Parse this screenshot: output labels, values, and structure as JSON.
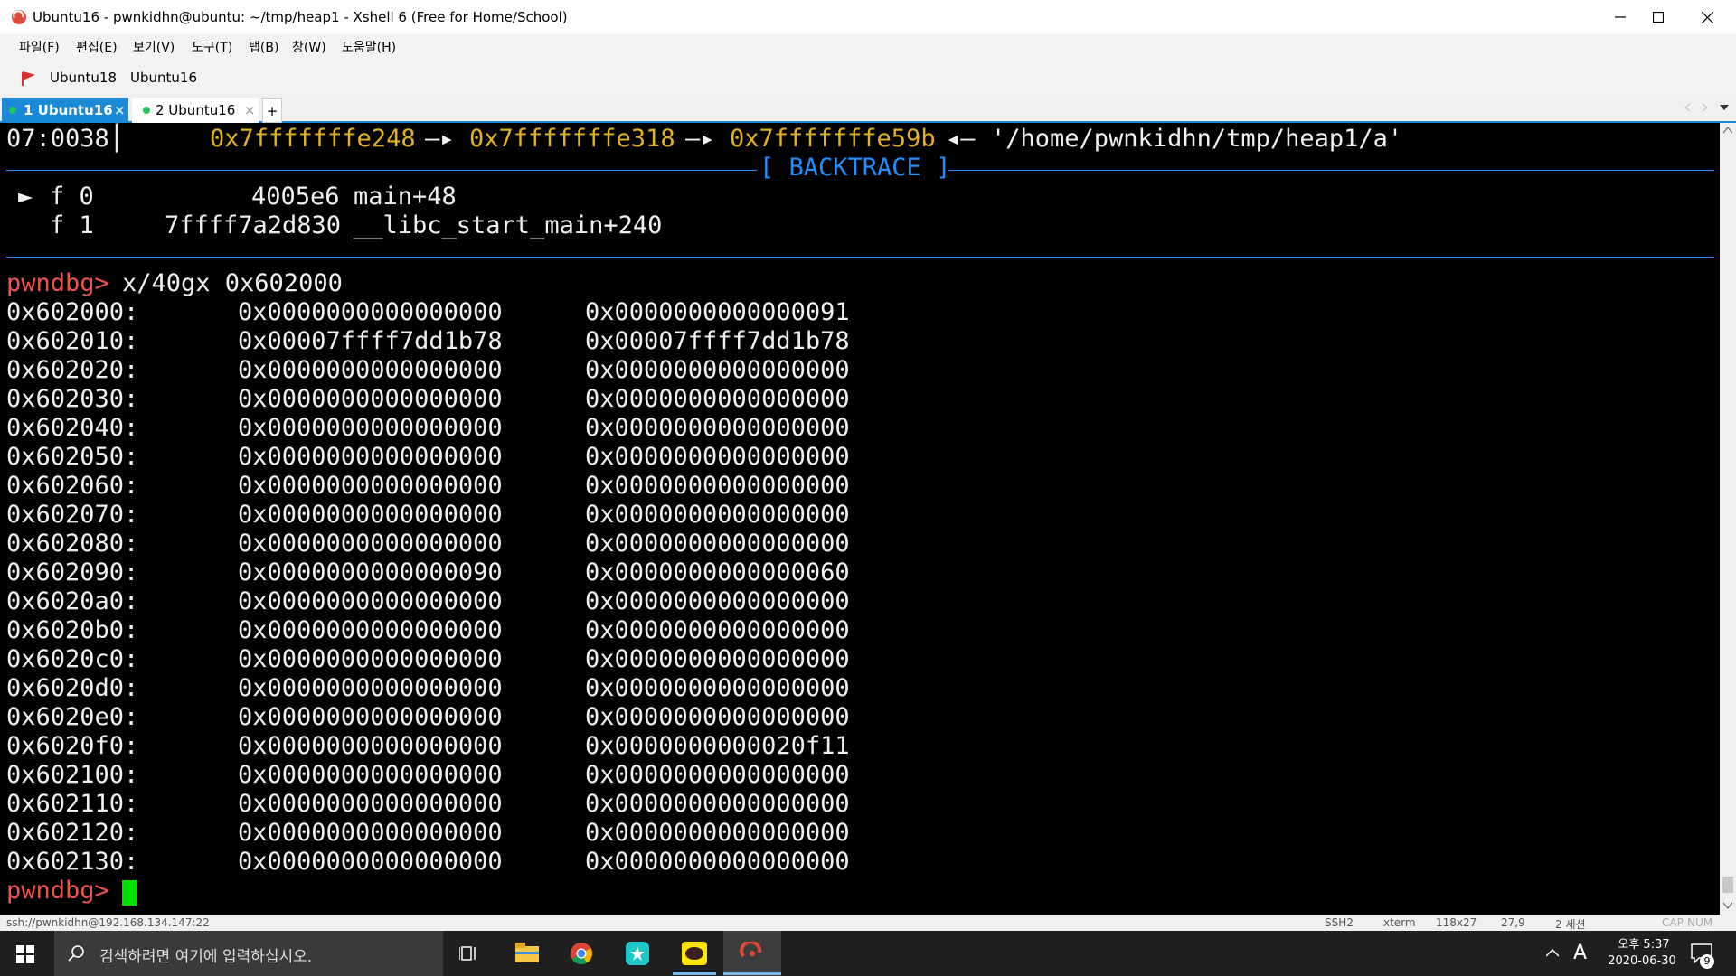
{
  "window": {
    "title": "Ubuntu16 - pwnkidhn@ubuntu: ~/tmp/heap1 - Xshell 6 (Free for Home/School)",
    "minimize": "—",
    "maximize": "☐",
    "close": "✕"
  },
  "menu": [
    "파일(F)",
    "편집(E)",
    "보기(V)",
    "도구(T)",
    "탭(B)",
    "창(W)",
    "도움말(H)"
  ],
  "links": [
    "Ubuntu18",
    "Ubuntu16"
  ],
  "tabs": [
    {
      "label": "1 Ubuntu16",
      "active": true,
      "close": "×"
    },
    {
      "label": "2 Ubuntu16",
      "active": false,
      "close": "×"
    }
  ],
  "new_tab": "+",
  "terminal": {
    "stack_line": {
      "index": "07:0038",
      "sep": "│",
      "p1": "0x7fffffffe248",
      "arrow1": "—▸",
      "p2": "0x7fffffffe318",
      "arrow2": "—▸",
      "p3": "0x7fffffffe59b",
      "arrow3": "◂—",
      "str": "'/home/pwnkidhn/tmp/heap1/a'"
    },
    "backtrace_label": "[ BACKTRACE ]",
    "frames": [
      {
        "marker": "►",
        "f": "f 0",
        "addr": "4005e6",
        "sym": "main+48"
      },
      {
        "marker": "",
        "f": "f 1",
        "addr": "7ffff7a2d830",
        "sym": "__libc_start_main+240"
      }
    ],
    "prompt": "pwndbg>",
    "command": "x/40gx 0x602000",
    "memory": [
      [
        "0x602000:",
        "0x0000000000000000",
        "0x0000000000000091"
      ],
      [
        "0x602010:",
        "0x00007ffff7dd1b78",
        "0x00007ffff7dd1b78"
      ],
      [
        "0x602020:",
        "0x0000000000000000",
        "0x0000000000000000"
      ],
      [
        "0x602030:",
        "0x0000000000000000",
        "0x0000000000000000"
      ],
      [
        "0x602040:",
        "0x0000000000000000",
        "0x0000000000000000"
      ],
      [
        "0x602050:",
        "0x0000000000000000",
        "0x0000000000000000"
      ],
      [
        "0x602060:",
        "0x0000000000000000",
        "0x0000000000000000"
      ],
      [
        "0x602070:",
        "0x0000000000000000",
        "0x0000000000000000"
      ],
      [
        "0x602080:",
        "0x0000000000000000",
        "0x0000000000000000"
      ],
      [
        "0x602090:",
        "0x0000000000000090",
        "0x0000000000000060"
      ],
      [
        "0x6020a0:",
        "0x0000000000000000",
        "0x0000000000000000"
      ],
      [
        "0x6020b0:",
        "0x0000000000000000",
        "0x0000000000000000"
      ],
      [
        "0x6020c0:",
        "0x0000000000000000",
        "0x0000000000000000"
      ],
      [
        "0x6020d0:",
        "0x0000000000000000",
        "0x0000000000000000"
      ],
      [
        "0x6020e0:",
        "0x0000000000000000",
        "0x0000000000000000"
      ],
      [
        "0x6020f0:",
        "0x0000000000000000",
        "0x0000000000020f11"
      ],
      [
        "0x602100:",
        "0x0000000000000000",
        "0x0000000000000000"
      ],
      [
        "0x602110:",
        "0x0000000000000000",
        "0x0000000000000000"
      ],
      [
        "0x602120:",
        "0x0000000000000000",
        "0x0000000000000000"
      ],
      [
        "0x602130:",
        "0x0000000000000000",
        "0x0000000000000000"
      ]
    ],
    "final_prompt": "pwndbg>"
  },
  "status": {
    "connection": "ssh://pwnkidhn@192.168.134.147:22",
    "protocol": "SSH2",
    "term": "xterm",
    "size": "118x27",
    "cursor": "27,9",
    "sessions": "2 세션",
    "cap": "CAP",
    "num": "NUM"
  },
  "taskbar": {
    "search_placeholder": "검색하려면 여기에 입력하십시오.",
    "ime": "A",
    "ampm_time": "오후 5:37",
    "date": "2020-06-30",
    "notif_count": "9"
  },
  "colors": {
    "accent": "#1a8ad8",
    "terminal_bg": "#000000",
    "terminal_fg": "#f0f0f0",
    "pointer_yellow": "#e3b21c",
    "backtrace_blue": "#1e90ff",
    "prompt_red": "#ef5350",
    "cursor_green": "#00e000"
  }
}
